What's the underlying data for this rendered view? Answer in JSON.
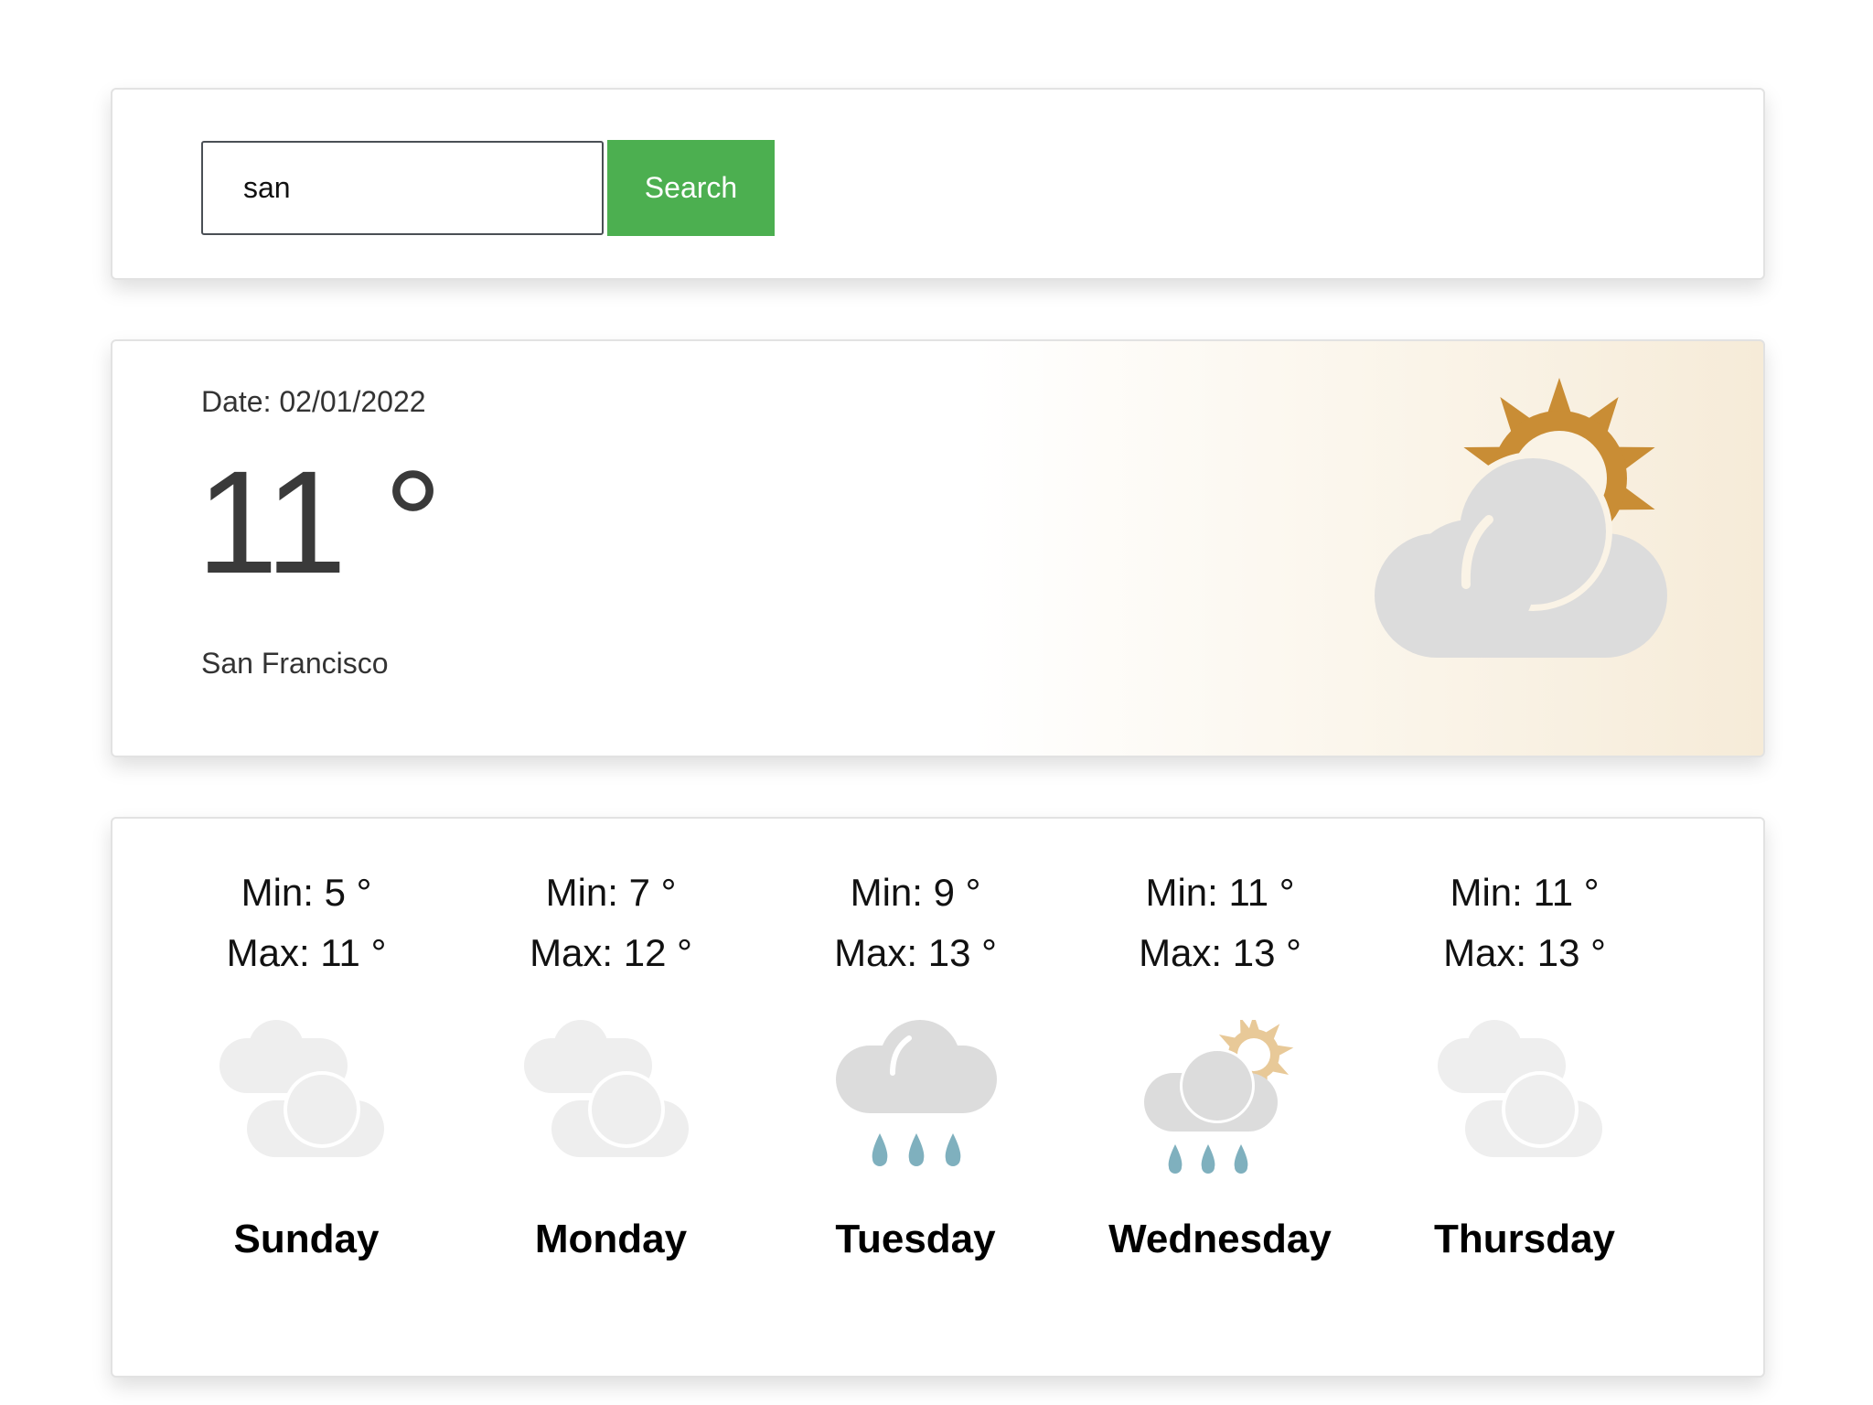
{
  "search": {
    "value": "san",
    "button_label": "Search"
  },
  "current": {
    "date_label": "Date: 02/01/2022",
    "temperature": "11 °",
    "city": "San Francisco",
    "icon": "partly-cloudy-sun-icon"
  },
  "forecast": [
    {
      "min": "Min: 5 °",
      "max": "Max: 11 °",
      "day": "Sunday",
      "icon": "clouds-icon"
    },
    {
      "min": "Min: 7 °",
      "max": "Max: 12 °",
      "day": "Monday",
      "icon": "clouds-icon"
    },
    {
      "min": "Min: 9 °",
      "max": "Max: 13 °",
      "day": "Tuesday",
      "icon": "rain-cloud-icon"
    },
    {
      "min": "Min: 11 °",
      "max": "Max: 13 °",
      "day": "Wednesday",
      "icon": "sun-rain-cloud-icon"
    },
    {
      "min": "Min: 11 °",
      "max": "Max: 13 °",
      "day": "Thursday",
      "icon": "clouds-icon"
    }
  ],
  "colors": {
    "search_button": "#4caf50",
    "sun": "#c98d35",
    "sun_light": "#e8c998",
    "cloud": "#dcdcdc",
    "cloud_light": "#eeeeee",
    "rain": "#7fb0be"
  }
}
